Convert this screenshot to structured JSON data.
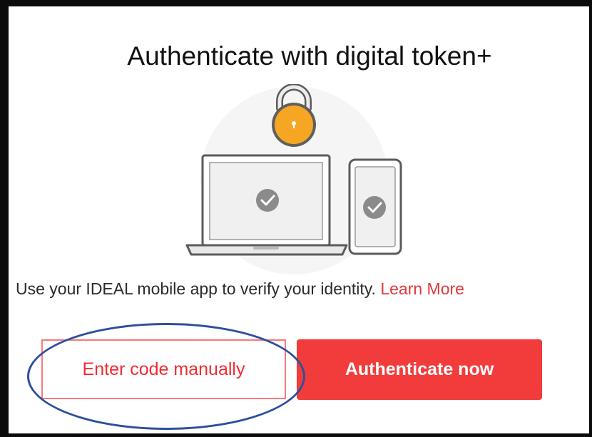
{
  "dialog": {
    "title": "Authenticate with digital token+",
    "description": "Use your IDEAL mobile app to verify your identity.",
    "learn_more_label": "Learn More"
  },
  "buttons": {
    "enter_code_label": "Enter code manually",
    "authenticate_label": "Authenticate now"
  },
  "illustration": {
    "icons": [
      "padlock-icon",
      "laptop-icon",
      "phone-icon",
      "checkmark-icon"
    ]
  },
  "colors": {
    "accent_red": "#f23c3c",
    "link_red": "#e2383c",
    "lock_orange": "#f6a623",
    "annotation_blue": "#2e4f9c"
  }
}
